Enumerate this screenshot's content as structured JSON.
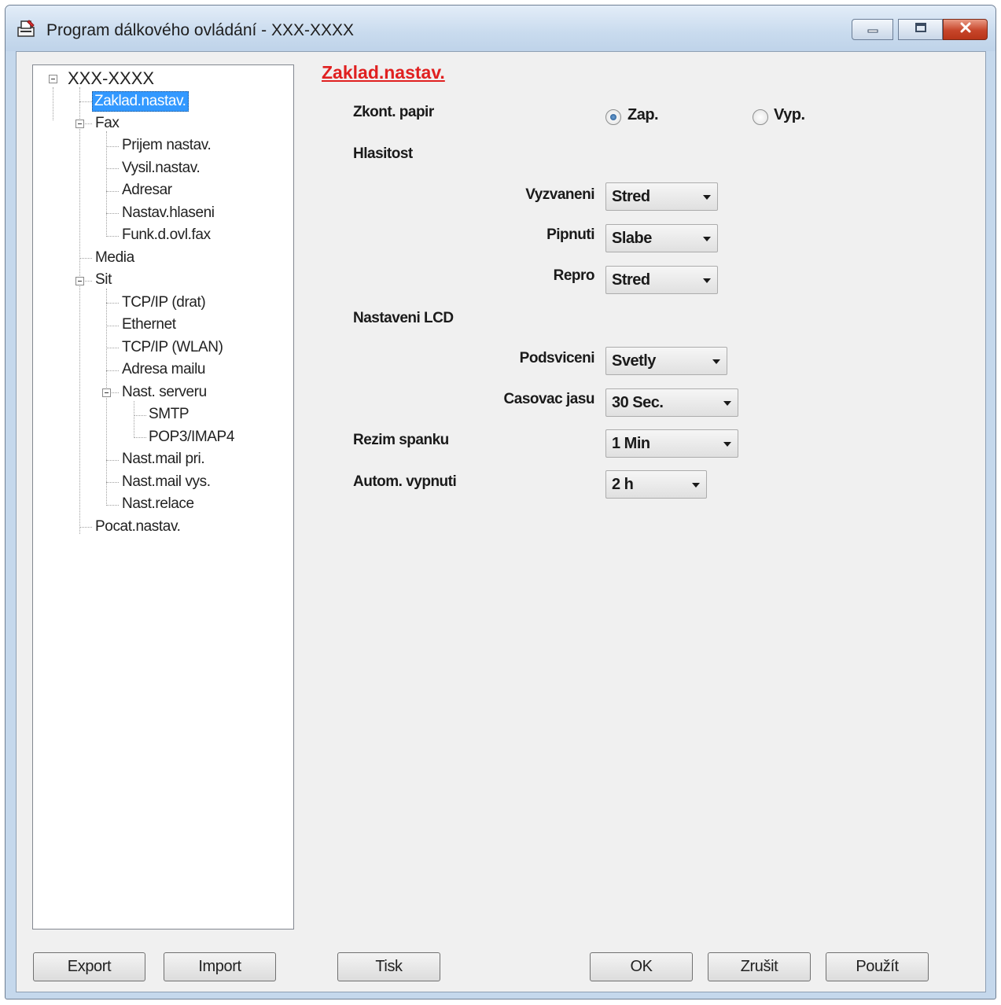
{
  "window": {
    "title": "Program dálkového ovládání - XXX-XXXX"
  },
  "tree": {
    "root": "XXX-XXXX",
    "items": {
      "zaklad": "Zaklad.nastav.",
      "fax": "Fax",
      "prijem": "Prijem nastav.",
      "vysil": "Vysil.nastav.",
      "adresar": "Adresar",
      "hlaseni": "Nastav.hlaseni",
      "funk": "Funk.d.ovl.fax",
      "media": "Media",
      "sit": "Sit",
      "tcpip_drat": "TCP/IP (drat)",
      "ethernet": "Ethernet",
      "tcpip_wlan": "TCP/IP (WLAN)",
      "adresa_mailu": "Adresa mailu",
      "nast_serveru": "Nast. serveru",
      "smtp": "SMTP",
      "pop3": "POP3/IMAP4",
      "mail_pri": "Nast.mail pri.",
      "mail_vys": "Nast.mail vys.",
      "relace": "Nast.relace",
      "pocat": "Pocat.nastav."
    }
  },
  "panel": {
    "section_title": "Zaklad.nastav.",
    "zkont_papir": {
      "label": "Zkont. papir",
      "options": {
        "on": "Zap.",
        "off": "Vyp."
      },
      "selected": "Zap."
    },
    "hlasitost": {
      "heading": "Hlasitost",
      "vyzvaneni": {
        "label": "Vyzvaneni",
        "value": "Stred"
      },
      "pipnuti": {
        "label": "Pipnuti",
        "value": "Slabe"
      },
      "repro": {
        "label": "Repro",
        "value": "Stred"
      }
    },
    "lcd": {
      "heading": "Nastaveni LCD",
      "podsviceni": {
        "label": "Podsviceni",
        "value": "Svetly"
      },
      "casovac": {
        "label": "Casovac jasu",
        "value": "30 Sec."
      }
    },
    "rezim_spanku": {
      "label": "Rezim spanku",
      "value": "1 Min"
    },
    "autom_vypnuti": {
      "label": "Autom. vypnuti",
      "value": "2 h"
    }
  },
  "buttons": {
    "export": "Export",
    "import": "Import",
    "tisk": "Tisk",
    "ok": "OK",
    "zrusit": "Zrušit",
    "pouzit": "Použít"
  },
  "icons": {
    "app": "printer-remote-icon",
    "minimize": "minimize-icon",
    "maximize": "maximize-icon",
    "close": "close-icon"
  },
  "colors": {
    "section_title": "#e02020",
    "selection": "#3399ff",
    "close_button": "#c7452a"
  }
}
